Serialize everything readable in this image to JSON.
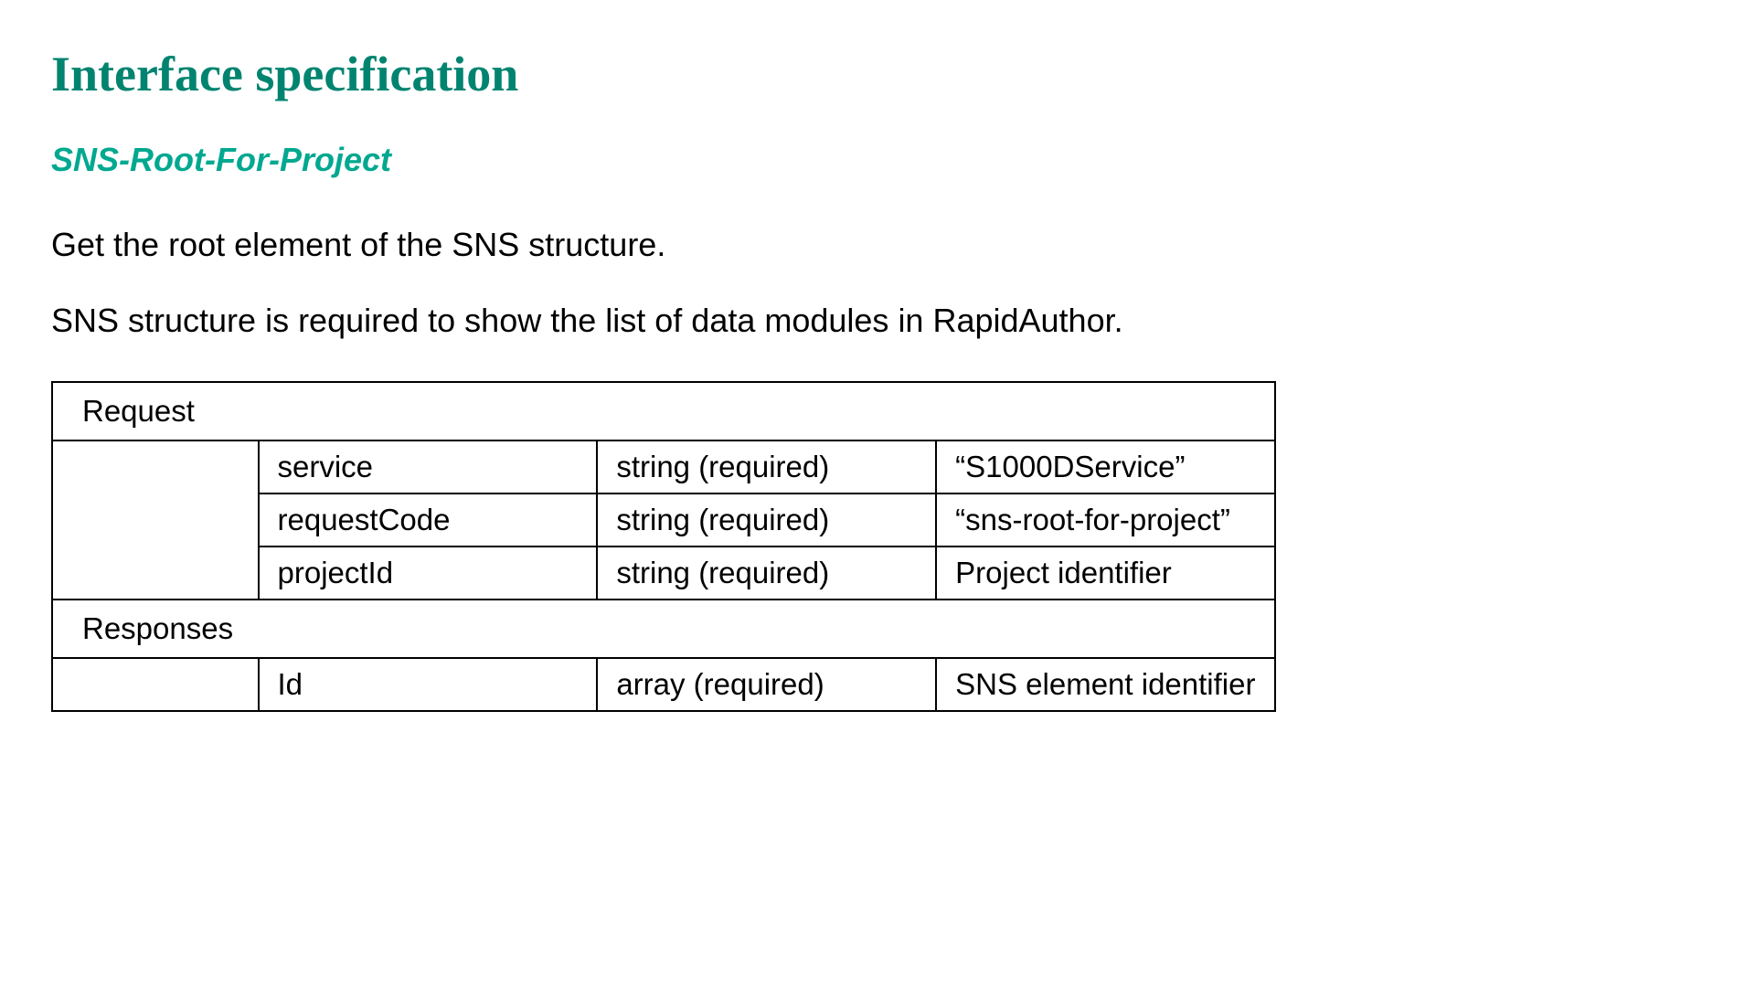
{
  "title": "Interface specification",
  "subtitle": "SNS-Root-For-Project",
  "description1": "Get the root element of the SNS structure.",
  "description2": "SNS structure is required to show the list of data modules in RapidAuthor.",
  "table": {
    "requestLabel": "Request",
    "responsesLabel": "Responses",
    "requestRows": [
      {
        "name": "service",
        "type": "string (required)",
        "desc": "“S1000DService”"
      },
      {
        "name": "requestCode",
        "type": "string (required)",
        "desc": "“sns-root-for-project”"
      },
      {
        "name": "projectId",
        "type": "string (required)",
        "desc": "Project identifier"
      }
    ],
    "responsesRows": [
      {
        "name": "Id",
        "type": "array (required)",
        "desc": "SNS element identifier"
      }
    ]
  }
}
